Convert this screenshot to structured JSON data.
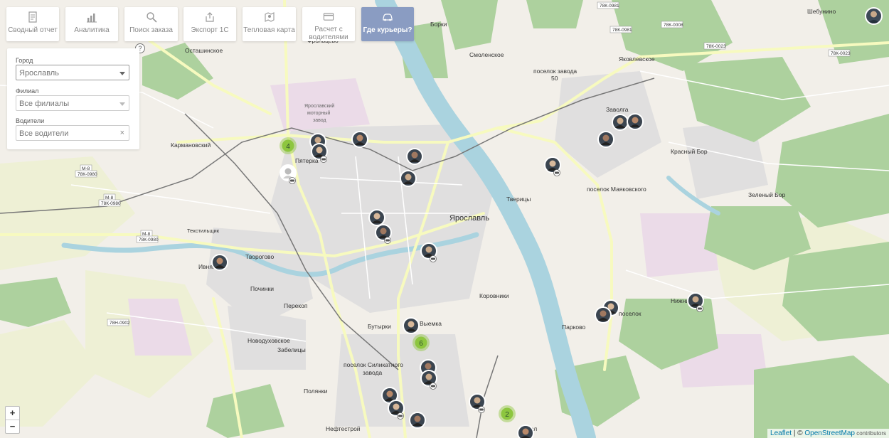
{
  "toolbar": {
    "items": [
      {
        "label": "Сводный отчет",
        "icon": "report-icon"
      },
      {
        "label": "Аналитика",
        "icon": "bar-chart-icon"
      },
      {
        "label": "Поиск заказа",
        "icon": "search-icon"
      },
      {
        "label": "Экспорт 1С",
        "icon": "export-icon"
      },
      {
        "label": "Тепловая карта",
        "icon": "heatmap-pin-icon"
      },
      {
        "label_line1": "Расчет с",
        "label_line2": "водителями",
        "icon": "card-icon"
      },
      {
        "label": "Где курьеры?",
        "icon": "car-icon",
        "active": true
      }
    ]
  },
  "filters": {
    "city_label": "Город",
    "city_value": "Ярославль",
    "branch_label": "Филиал",
    "branch_value": "Все филиалы",
    "drivers_label": "Водители",
    "drivers_value": "Все водители",
    "help": "?",
    "clear": "×"
  },
  "zoom": {
    "in": "+",
    "out": "−"
  },
  "attribution": {
    "leaflet": "Leaflet",
    "sep": " | © ",
    "osm": "OpenStreetMap",
    "contrib": " contributors"
  },
  "colors": {
    "cluster": "#8dc63f",
    "toolbar_active": "#8a9cc2",
    "water": "#aad3df",
    "forest": "#add19e",
    "road_yellow": "#f7fabf"
  },
  "clusters": [
    "4",
    "6",
    "2"
  ],
  "map_labels": {
    "yaroslavl": "Ярославль",
    "tveritsy": "Тверицы",
    "zavolga": "Заволга",
    "yakovlevskoe": "Яковлевское",
    "smolenskoe": "Смоленское",
    "borki": "Борки",
    "karmanovsky": "Кармановский",
    "pyaterka": "Пятерка",
    "tvorogovo": "Творогово",
    "ivnyaki": "Ивняки",
    "pochinki": "Починки",
    "perekop": "Перекоп",
    "novodukhovskoe": "Новодуховское",
    "zabelitsy": "Забелицы",
    "butyrki": "Бутырки",
    "vyemka": "Выемка",
    "korovniki": "Коровники",
    "parkovo": "Парково",
    "poselok_silikat": "поселок Силикатного",
    "zavoda": "завода",
    "polyanki": "Полянки",
    "neftestroy": "Нефтестрой",
    "krasny_bor": "Красный Бор",
    "zeleny_bor": "Зеленый Бор",
    "poselok_mayakovskogo": "поселок Маяковского",
    "poselok_zavoda": "поселок завода",
    "n50": "50",
    "ostashinskoe": "Осташинское",
    "frolovtsevo": "Фрольцево",
    "shebunino": "Шебунино",
    "road_78k0981": "78К-0981",
    "road_78k0008": "78К-0008",
    "road_78k0023": "78К-0023",
    "road_m8": "М-8",
    "road_78k0980": "78К-0980",
    "road_78n0902": "78Н-0902",
    "tekstilschik": "Текстильщик",
    "motor_plant1": "Ярославский",
    "motor_plant2": "моторный",
    "motor_plant3": "завод",
    "nizhny": "Нижний",
    "poselok": "поселок",
    "sokol": "Сокол"
  }
}
